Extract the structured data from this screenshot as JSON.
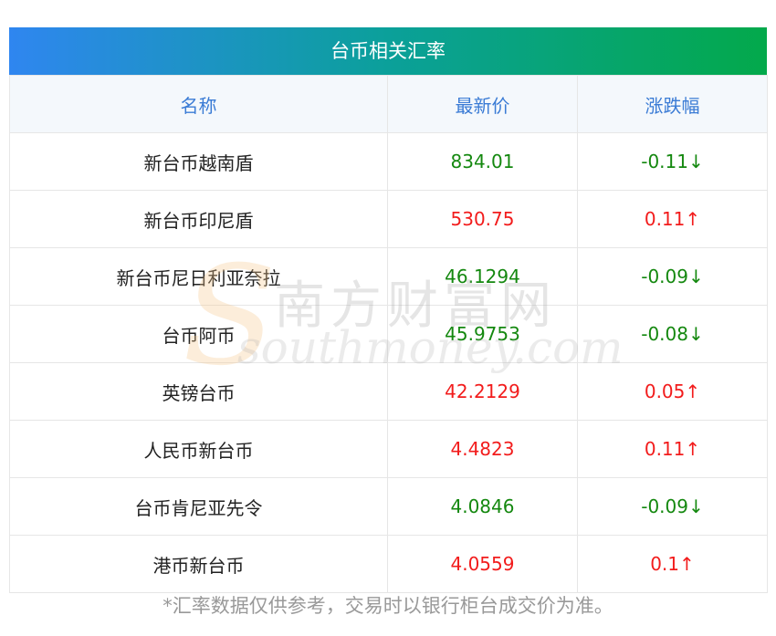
{
  "table": {
    "title": "台币相关汇率",
    "headers": {
      "name": "名称",
      "price": "最新价",
      "change": "涨跌幅"
    },
    "rows": [
      {
        "name": "新台币越南盾",
        "price": "834.01",
        "change": "-0.11↓",
        "trend": "down"
      },
      {
        "name": "新台币印尼盾",
        "price": "530.75",
        "change": "0.11↑",
        "trend": "up"
      },
      {
        "name": "新台币尼日利亚奈拉",
        "price": "46.1294",
        "change": "-0.09↓",
        "trend": "down"
      },
      {
        "name": "台币阿币",
        "price": "45.9753",
        "change": "-0.08↓",
        "trend": "down"
      },
      {
        "name": "英镑台币",
        "price": "42.2129",
        "change": "0.05↑",
        "trend": "up"
      },
      {
        "name": "人民币新台币",
        "price": "4.4823",
        "change": "0.11↑",
        "trend": "up"
      },
      {
        "name": "台币肯尼亚先令",
        "price": "4.0846",
        "change": "-0.09↓",
        "trend": "down"
      },
      {
        "name": "港币新台币",
        "price": "4.0559",
        "change": "0.1↑",
        "trend": "up"
      }
    ]
  },
  "footnote": "*汇率数据仅供参考，交易时以银行柜台成交价为准。",
  "watermark": {
    "cn": "南方财富网",
    "en": "southmoney.com"
  },
  "colors": {
    "up": "#f21c1c",
    "down": "#14880f",
    "header_text": "#3a7bd5"
  }
}
